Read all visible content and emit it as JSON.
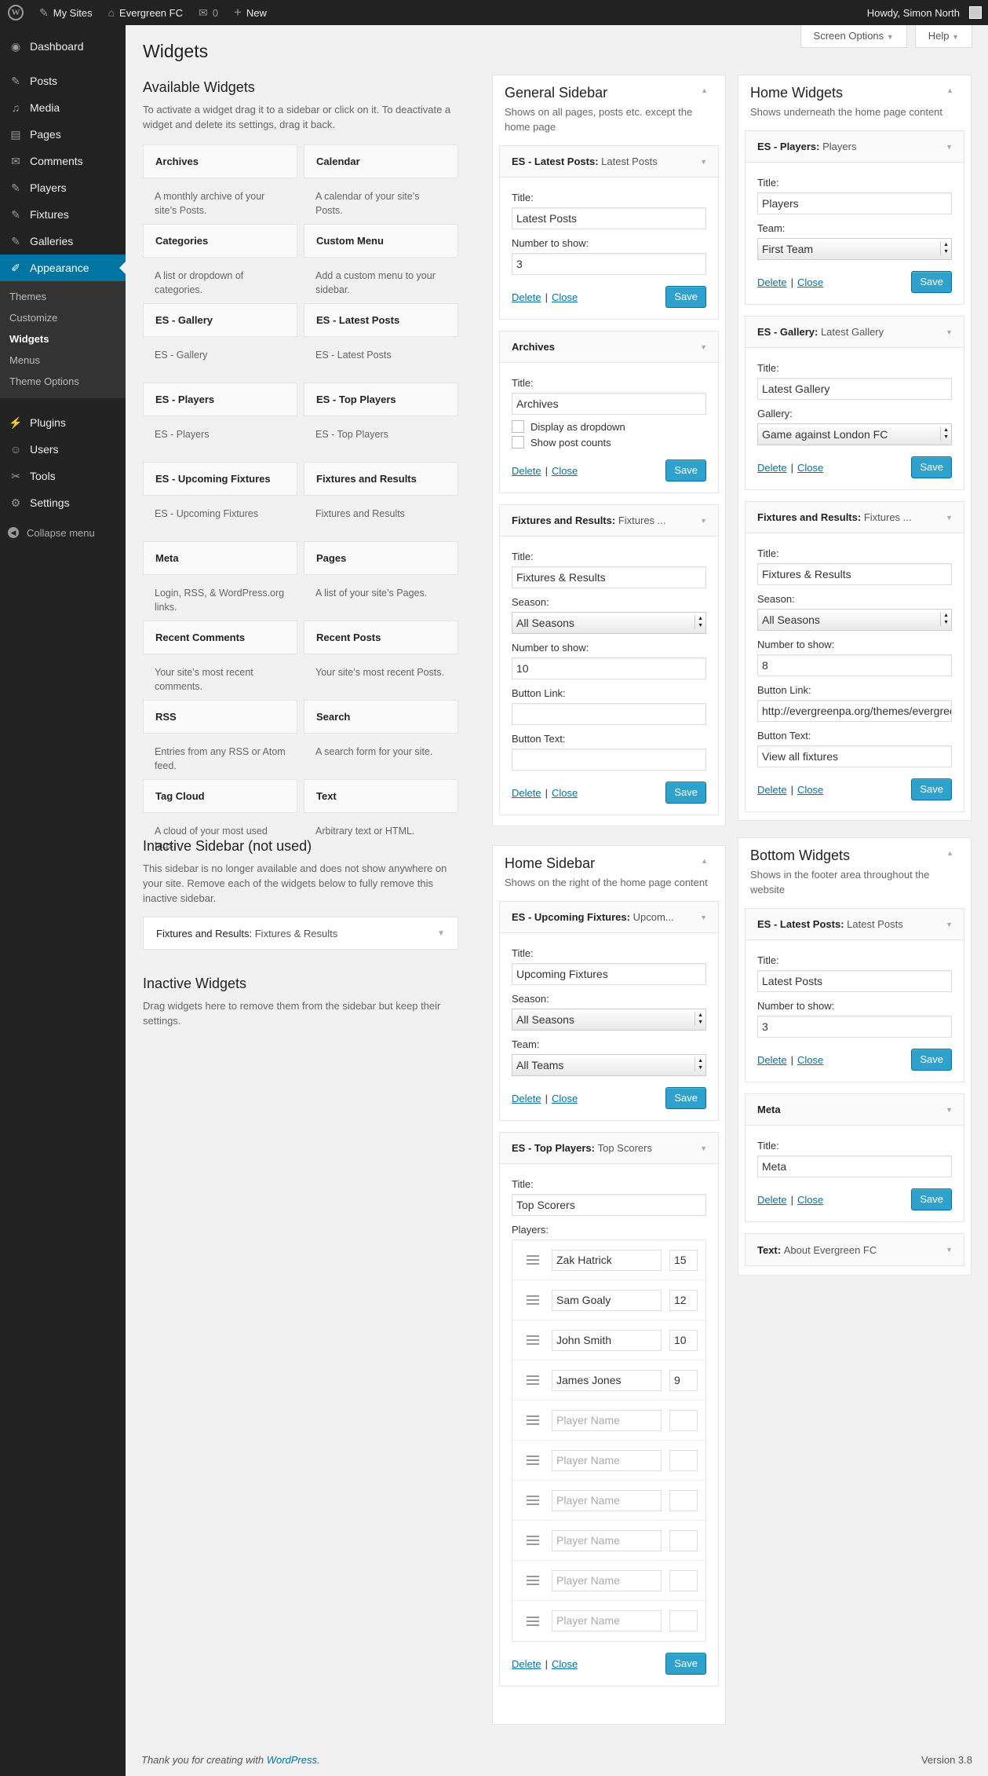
{
  "adminbar": {
    "wp_logo": "W",
    "my_sites": "My Sites",
    "site_name": "Evergreen FC",
    "comments_count": "0",
    "new_label": "New",
    "howdy": "Howdy, Simon North"
  },
  "sidebar": {
    "items": [
      {
        "label": "Dashboard",
        "icon": "dashboard-icon",
        "glyph": "◉"
      },
      {
        "label": "Posts",
        "icon": "pin-icon",
        "glyph": "✎"
      },
      {
        "label": "Media",
        "icon": "media-icon",
        "glyph": "♫"
      },
      {
        "label": "Pages",
        "icon": "page-icon",
        "glyph": "▤"
      },
      {
        "label": "Comments",
        "icon": "comment-icon",
        "glyph": "✉"
      },
      {
        "label": "Players",
        "icon": "pin-icon",
        "glyph": "✎"
      },
      {
        "label": "Fixtures",
        "icon": "pin-icon",
        "glyph": "✎"
      },
      {
        "label": "Galleries",
        "icon": "pin-icon",
        "glyph": "✎"
      },
      {
        "label": "Appearance",
        "icon": "brush-icon",
        "glyph": "✐"
      },
      {
        "label": "Plugins",
        "icon": "plugin-icon",
        "glyph": "⚡"
      },
      {
        "label": "Users",
        "icon": "users-icon",
        "glyph": "☺"
      },
      {
        "label": "Tools",
        "icon": "wrench-icon",
        "glyph": "✂"
      },
      {
        "label": "Settings",
        "icon": "settings-icon",
        "glyph": "⚙"
      }
    ],
    "submenu": [
      "Themes",
      "Customize",
      "Widgets",
      "Menus",
      "Theme Options"
    ],
    "collapse": "Collapse menu"
  },
  "screen_options": "Screen Options",
  "help": "Help",
  "page_title": "Widgets",
  "available": {
    "title": "Available Widgets",
    "desc": "To activate a widget drag it to a sidebar or click on it. To deactivate a widget and delete its settings, drag it back.",
    "widgets": [
      {
        "title": "Archives",
        "desc": "A monthly archive of your site’s Posts."
      },
      {
        "title": "Calendar",
        "desc": "A calendar of your site’s Posts."
      },
      {
        "title": "Categories",
        "desc": "A list or dropdown of categories."
      },
      {
        "title": "Custom Menu",
        "desc": "Add a custom menu to your sidebar."
      },
      {
        "title": "ES - Gallery",
        "desc": "ES - Gallery"
      },
      {
        "title": "ES - Latest Posts",
        "desc": "ES - Latest Posts"
      },
      {
        "title": "ES - Players",
        "desc": "ES - Players"
      },
      {
        "title": "ES - Top Players",
        "desc": "ES - Top Players"
      },
      {
        "title": "ES - Upcoming Fixtures",
        "desc": "ES - Upcoming Fixtures"
      },
      {
        "title": "Fixtures and Results",
        "desc": "Fixtures and Results"
      },
      {
        "title": "Meta",
        "desc": "Login, RSS, & WordPress.org links."
      },
      {
        "title": "Pages",
        "desc": "A list of your site’s Pages."
      },
      {
        "title": "Recent Comments",
        "desc": "Your site’s most recent comments."
      },
      {
        "title": "Recent Posts",
        "desc": "Your site’s most recent Posts."
      },
      {
        "title": "RSS",
        "desc": "Entries from any RSS or Atom feed."
      },
      {
        "title": "Search",
        "desc": "A search form for your site."
      },
      {
        "title": "Tag Cloud",
        "desc": "A cloud of your most used tags."
      },
      {
        "title": "Text",
        "desc": "Arbitrary text or HTML."
      }
    ]
  },
  "inactive_sidebar": {
    "title": "Inactive Sidebar (not used)",
    "desc": "This sidebar is no longer available and does not show anywhere on your site. Remove each of the widgets below to fully remove this inactive sidebar.",
    "widget_name": "Fixtures and Results:",
    "widget_title": "Fixtures & Results"
  },
  "inactive_widgets": {
    "title": "Inactive Widgets",
    "desc": "Drag widgets here to remove them from the sidebar but keep their settings."
  },
  "labels": {
    "title": "Title:",
    "number_to_show": "Number to show:",
    "season": "Season:",
    "team": "Team:",
    "gallery": "Gallery:",
    "button_link": "Button Link:",
    "button_text": "Button Text:",
    "players": "Players:",
    "display_dropdown": "Display as dropdown",
    "show_counts": "Show post counts",
    "delete": "Delete",
    "close": "Close",
    "save": "Save",
    "pipe": "|"
  },
  "general_sidebar": {
    "title": "General Sidebar",
    "desc": "Shows on all pages, posts etc. except the home page",
    "latest_posts": {
      "name": "ES - Latest Posts:",
      "in": "Latest Posts",
      "title": "Latest Posts",
      "number": "3"
    },
    "archives": {
      "name": "Archives",
      "title": "Archives"
    },
    "fixtures": {
      "name": "Fixtures and Results:",
      "in": "Fixtures ...",
      "title": "Fixtures & Results",
      "season": "All Seasons",
      "number": "10",
      "button_link": "",
      "button_text": ""
    }
  },
  "home_sidebar": {
    "title": "Home Sidebar",
    "desc": "Shows on the right of the home page content",
    "upcoming": {
      "name": "ES - Upcoming Fixtures:",
      "in": "Upcom...",
      "title": "Upcoming Fixtures",
      "season": "All Seasons",
      "team": "All Teams"
    },
    "top_players": {
      "name": "ES - Top Players:",
      "in": "Top Scorers",
      "title": "Top Scorers",
      "placeholder": "Player Name",
      "players": [
        {
          "name": "Zak Hatrick",
          "count": "15"
        },
        {
          "name": "Sam Goaly",
          "count": "12"
        },
        {
          "name": "John Smith",
          "count": "10"
        },
        {
          "name": "James Jones",
          "count": "9"
        },
        {
          "name": "",
          "count": ""
        },
        {
          "name": "",
          "count": ""
        },
        {
          "name": "",
          "count": ""
        },
        {
          "name": "",
          "count": ""
        },
        {
          "name": "",
          "count": ""
        },
        {
          "name": "",
          "count": ""
        }
      ]
    }
  },
  "home_widgets": {
    "title": "Home Widgets",
    "desc": "Shows underneath the home page content",
    "players": {
      "name": "ES - Players:",
      "in": "Players",
      "title": "Players",
      "team": "First Team"
    },
    "gallery": {
      "name": "ES - Gallery:",
      "in": "Latest Gallery",
      "title": "Latest Gallery",
      "gallery": "Game against London FC"
    },
    "fixtures": {
      "name": "Fixtures and Results:",
      "in": "Fixtures ...",
      "title": "Fixtures & Results",
      "season": "All Seasons",
      "number": "8",
      "button_link": "http://evergreenpa.org/themes/evergreen",
      "button_text": "View all fixtures"
    }
  },
  "bottom_widgets": {
    "title": "Bottom Widgets",
    "desc": "Shows in the footer area throughout the website",
    "latest_posts": {
      "name": "ES - Latest Posts:",
      "in": "Latest Posts",
      "title": "Latest Posts",
      "number": "3"
    },
    "meta": {
      "name": "Meta",
      "title": "Meta"
    },
    "text": {
      "name": "Text:",
      "in": "About Evergreen FC"
    }
  },
  "footer": {
    "thanks": "Thank you for creating with",
    "wp_link": "WordPress",
    "period": ".",
    "version": "Version 3.8"
  }
}
